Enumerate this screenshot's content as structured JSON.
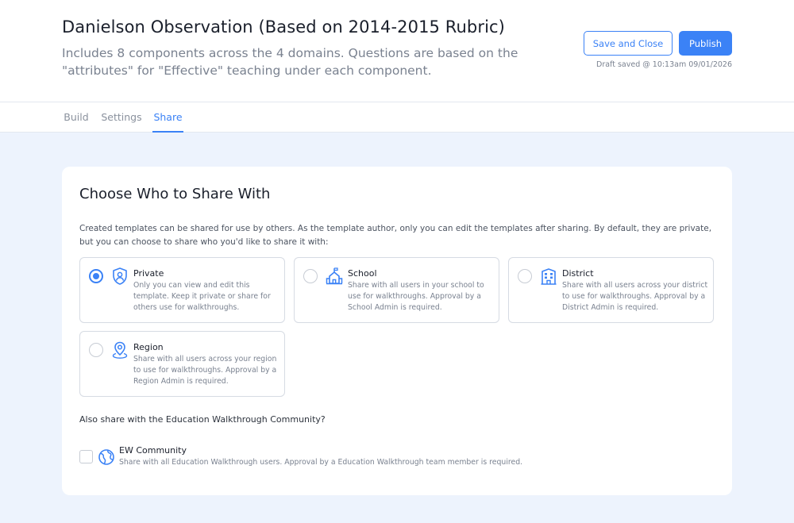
{
  "header": {
    "title": "Danielson Observation (Based on 2014-2015 Rubric)",
    "subtitle": "Includes 8 components across the 4 domains. Questions are based on the \"attributes\" for \"Effective\" teaching under each component.",
    "save_close_label": "Save and Close",
    "publish_label": "Publish",
    "draft_status": "Draft saved @ 10:13am 09/01/2026"
  },
  "tabs": [
    {
      "label": "Build",
      "active": false
    },
    {
      "label": "Settings",
      "active": false
    },
    {
      "label": "Share",
      "active": true
    }
  ],
  "share": {
    "title": "Choose Who to Share With",
    "description": "Created templates can be shared for use by others. As the template author, only you can edit the templates after sharing. By default, they are private, but you can choose to share who you'd like to share it with:",
    "selected": "Private",
    "options": [
      {
        "label": "Private",
        "icon": "shield-user-icon",
        "description": "Only you can view and edit this template. Keep it private or share for others use for walkthroughs."
      },
      {
        "label": "School",
        "icon": "school-icon",
        "description": "Share with all users in your school to use for walkthroughs. Approval by a School Admin is required."
      },
      {
        "label": "District",
        "icon": "building-icon",
        "description": "Share with all users across your district to use for walkthroughs. Approval by a District Admin is required."
      },
      {
        "label": "Region",
        "icon": "map-pin-icon",
        "description": "Share with all users across your region to use for walkthroughs. Approval by a Region Admin is required."
      }
    ],
    "community_question": "Also share with the Education Walkthrough Community?",
    "community": {
      "label": "EW Community",
      "icon": "globe-icon",
      "description": "Share with all Education Walkthrough users. Approval by a Education Walkthrough team member is required.",
      "checked": false
    }
  },
  "colors": {
    "accent": "#3b82f6",
    "page_background": "#edf3fd"
  }
}
